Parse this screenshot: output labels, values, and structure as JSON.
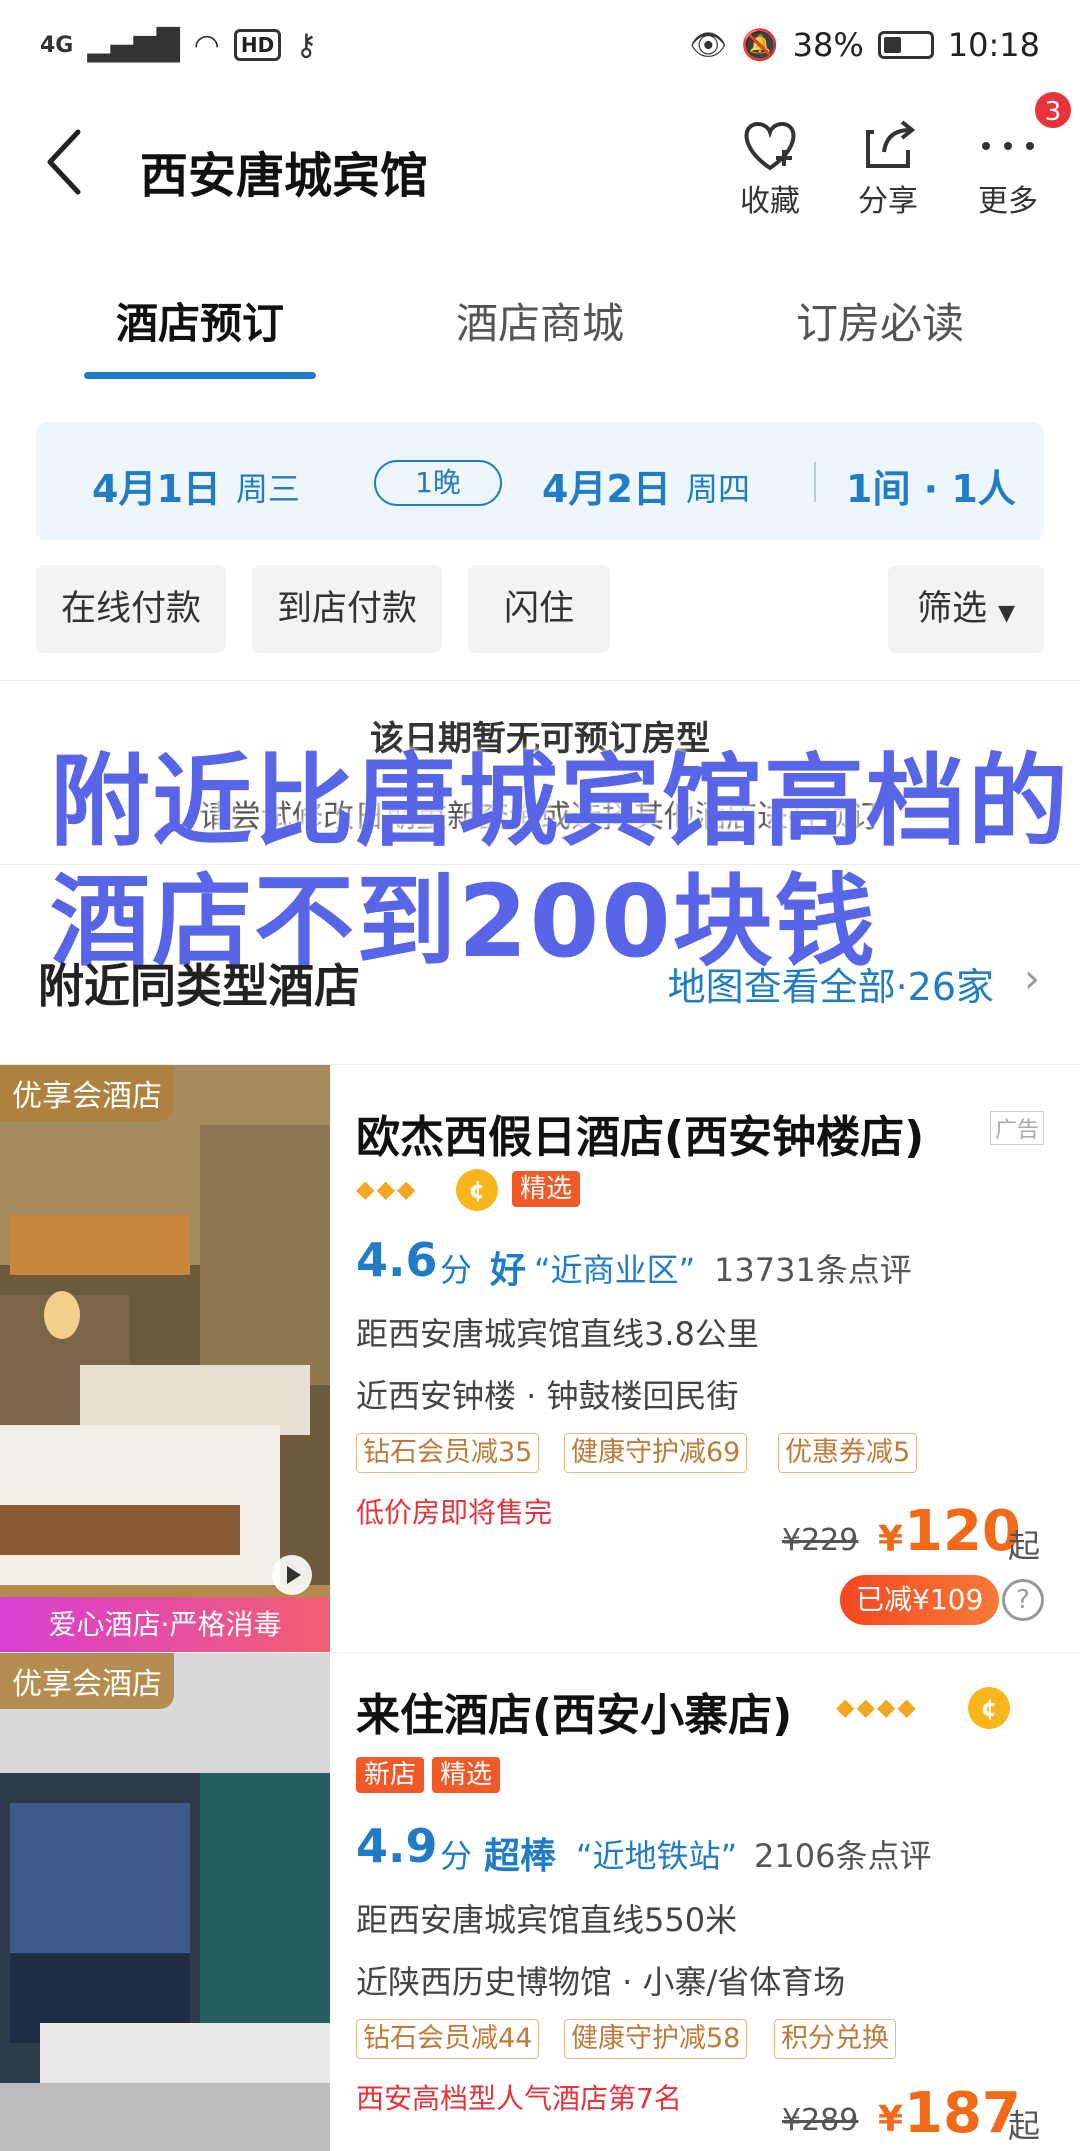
{
  "status_bar": {
    "network": "4G",
    "hd": "HD",
    "battery_percent": "38%",
    "battery_level": 0.38,
    "time": "10:18"
  },
  "header": {
    "title": "西安唐城宾馆",
    "actions": [
      {
        "label": "收藏",
        "icon": "heart-plus-icon"
      },
      {
        "label": "分享",
        "icon": "share-icon"
      },
      {
        "label": "更多",
        "icon": "more-dots-icon"
      }
    ],
    "more_badge": "3"
  },
  "tabs": [
    {
      "label": "酒店预订",
      "active": true
    },
    {
      "label": "酒店商城",
      "active": false
    },
    {
      "label": "订房必读",
      "active": false
    }
  ],
  "dates": {
    "checkin_date": "4月1日",
    "checkin_weekday": "周三",
    "nights": "1晚",
    "checkout_date": "4月2日",
    "checkout_weekday": "周四",
    "rooms_guests": "1间 · 1人"
  },
  "filters": {
    "chips": [
      "在线付款",
      "到店付款",
      "闪住"
    ],
    "filter_label": "筛选"
  },
  "notice": {
    "title": "该日期暂无可预订房型",
    "subtitle": "请尝试修改日期重新查询或选择其他酒店进行预订"
  },
  "overlay": {
    "line1": "附近比唐城宾馆高档的",
    "line2": "酒店不到200块钱"
  },
  "section": {
    "title": "附近同类型酒店",
    "map_link": "地图查看全部·26家"
  },
  "hotels": [
    {
      "name": "欧杰西假日酒店(西安钟楼店)",
      "ad_tag": "广告",
      "thumb_tag": "优享会酒店",
      "thumb_bottom": "爱心酒店·严格消毒",
      "badges": [
        "精选"
      ],
      "score": "4.6",
      "score_unit": "分",
      "score_word": "好",
      "score_tag": "“近商业区”",
      "reviews": "13731条点评",
      "distance": "距西安唐城宾馆直线3.8公里",
      "location": "近西安钟楼 · 钟鼓楼回民街",
      "promos": [
        "钻石会员减35",
        "健康守护减69",
        "优惠券减5"
      ],
      "note": "低价房即将售完",
      "original_price": "¥229",
      "currency": "¥",
      "price": "120",
      "price_suffix": "起",
      "discount": "已减¥109"
    },
    {
      "name": "来住酒店(西安小寨店)",
      "thumb_tag": "优享会酒店",
      "badges": [
        "新店",
        "精选"
      ],
      "score": "4.9",
      "score_unit": "分",
      "score_word": "超棒",
      "score_tag": "“近地铁站”",
      "reviews": "2106条点评",
      "distance": "距西安唐城宾馆直线550米",
      "location": "近陕西历史博物馆 · 小寨/省体育场",
      "promos": [
        "钻石会员减44",
        "健康守护减58",
        "积分兑换"
      ],
      "note": "西安高档型人气酒店第7名",
      "original_price": "¥289",
      "currency": "¥",
      "price": "187",
      "price_suffix": "起"
    }
  ],
  "colors": {
    "accent_blue": "#1f7cc5",
    "price_orange": "#f06a1a",
    "overlay_purple": "#5865e6",
    "badge_red": "#e8333c"
  }
}
